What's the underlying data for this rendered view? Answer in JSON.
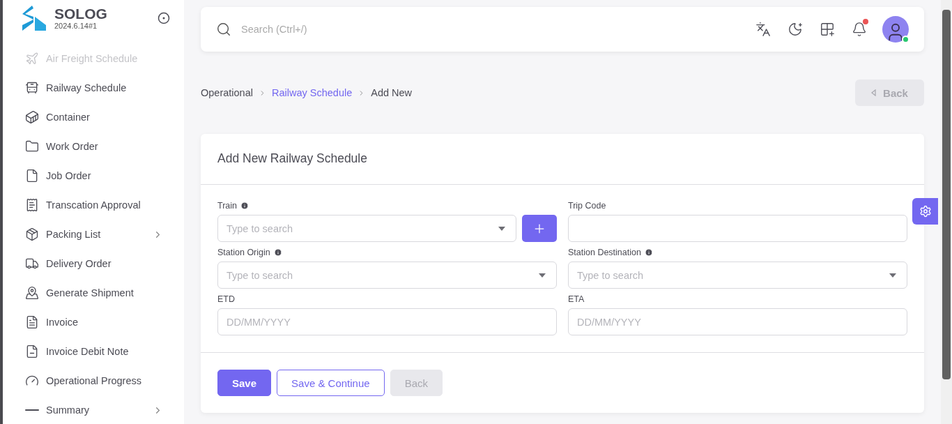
{
  "brand": {
    "name": "SOLOG",
    "version": "2024.6.14#1"
  },
  "sidebar": {
    "items": [
      {
        "label": "Air Freight Schedule",
        "disabled": true,
        "has_children": false
      },
      {
        "label": "Railway Schedule",
        "disabled": false,
        "has_children": false
      },
      {
        "label": "Container",
        "disabled": false,
        "has_children": false
      },
      {
        "label": "Work Order",
        "disabled": false,
        "has_children": false
      },
      {
        "label": "Job Order",
        "disabled": false,
        "has_children": false
      },
      {
        "label": "Transcation Approval",
        "disabled": false,
        "has_children": false
      },
      {
        "label": "Packing List",
        "disabled": false,
        "has_children": true
      },
      {
        "label": "Delivery Order",
        "disabled": false,
        "has_children": false
      },
      {
        "label": "Generate Shipment",
        "disabled": false,
        "has_children": false
      },
      {
        "label": "Invoice",
        "disabled": false,
        "has_children": false
      },
      {
        "label": "Invoice Debit Note",
        "disabled": false,
        "has_children": false
      },
      {
        "label": "Operational Progress",
        "disabled": false,
        "has_children": false
      },
      {
        "label": "Summary",
        "disabled": false,
        "has_children": true
      }
    ]
  },
  "topbar": {
    "search": {
      "placeholder": "Search (Ctrl+/)"
    },
    "notification": true,
    "online": true
  },
  "breadcrumb": [
    {
      "label": "Operational",
      "link": false
    },
    {
      "label": "Railway Schedule",
      "link": true
    },
    {
      "label": "Add New",
      "link": false
    }
  ],
  "back_button": {
    "label": "Back",
    "disabled": true
  },
  "form": {
    "title": "Add New Railway Schedule",
    "fields": [
      {
        "label": "Train",
        "kind": "select",
        "info": true,
        "add_button": true,
        "placeholder": "Type to search"
      },
      {
        "label": "Trip Code",
        "kind": "text",
        "info": false,
        "add_button": false
      },
      {
        "label": "Station Origin",
        "kind": "select",
        "info": true,
        "add_button": false,
        "placeholder": "Type to search"
      },
      {
        "label": "Station Destination",
        "kind": "select",
        "info": true,
        "add_button": false,
        "placeholder": "Type to search"
      },
      {
        "label": "ETD",
        "kind": "date",
        "info": false,
        "add_button": false,
        "placeholder": "DD/MM/YYYY"
      },
      {
        "label": "ETA",
        "kind": "date",
        "info": false,
        "add_button": false,
        "placeholder": "DD/MM/YYYY"
      }
    ],
    "buttons": [
      {
        "label": "Save",
        "kind": "primary",
        "disabled": false
      },
      {
        "label": "Save & Continue",
        "kind": "outline",
        "disabled": false
      },
      {
        "label": "Back",
        "kind": "plain",
        "disabled": true
      }
    ]
  }
}
